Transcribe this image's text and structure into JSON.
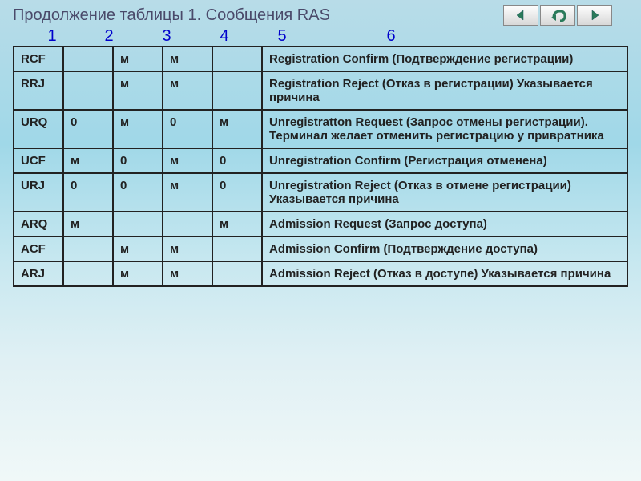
{
  "title": "Продолжение таблицы 1. Сообщения RAS",
  "colnums": [
    "1",
    "2",
    "3",
    "4",
    "5",
    "6"
  ],
  "rows": [
    {
      "c1": "RCF",
      "c2": "",
      "c3": "м",
      "c4": "м",
      "c5": "",
      "c6": "Registration Confirm (Подтверждение регистрации)"
    },
    {
      "c1": "RRJ",
      "c2": "",
      "c3": "м",
      "c4": "м",
      "c5": "",
      "c6": "Registration Reject (Отказ в регистрации) Указывается причина"
    },
    {
      "c1": "URQ",
      "c2": "0",
      "c3": "м",
      "c4": "0",
      "c5": "м",
      "c6": "Unregistratton Request (Запрос отмены регистрации). Терминал желает отменить регистрацию у привратника"
    },
    {
      "c1": "UCF",
      "c2": "м",
      "c3": "0",
      "c4": "м",
      "c5": "0",
      "c6": "Unregistration Confirm (Регистрация отменена)"
    },
    {
      "c1": "URJ",
      "c2": "0",
      "c3": "0",
      "c4": "м",
      "c5": "0",
      "c6": "Unregistration Reject (Отказ в отмене регистрации) Указывается причина"
    },
    {
      "c1": "ARQ",
      "c2": "м",
      "c3": "",
      "c4": "",
      "c5": "м",
      "c6": "Admission Request (Запрос доступа)"
    },
    {
      "c1": "ACF",
      "c2": "",
      "c3": "м",
      "c4": "м",
      "c5": "",
      "c6": "Admission Confirm (Подтверждение доступа)"
    },
    {
      "c1": "ARJ",
      "c2": "",
      "c3": "м",
      "c4": "м",
      "c5": "",
      "c6": "Admission Reject (Отказ в доступе) Указывается причина"
    }
  ]
}
